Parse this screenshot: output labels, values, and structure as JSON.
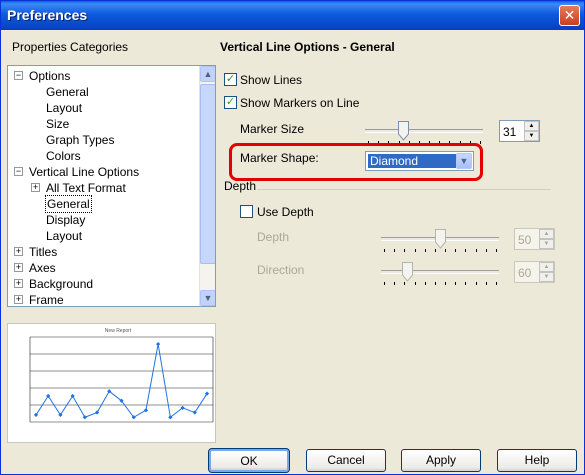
{
  "window": {
    "title": "Preferences"
  },
  "left_panel": {
    "heading": "Properties Categories",
    "tree": [
      {
        "label": "Options",
        "expander": "−",
        "level": 0
      },
      {
        "label": "General",
        "level": 1
      },
      {
        "label": "Layout",
        "level": 1
      },
      {
        "label": "Size",
        "level": 1
      },
      {
        "label": "Graph Types",
        "level": 1
      },
      {
        "label": "Colors",
        "level": 1
      },
      {
        "label": "Vertical Line Options",
        "expander": "−",
        "level": 0
      },
      {
        "label": "All Text Format",
        "expander": "+",
        "level": 1
      },
      {
        "label": "General",
        "level": 1,
        "selected": true
      },
      {
        "label": "Display",
        "level": 1
      },
      {
        "label": "Layout",
        "level": 1
      },
      {
        "label": "Titles",
        "expander": "+",
        "level": 0
      },
      {
        "label": "Axes",
        "expander": "+",
        "level": 0
      },
      {
        "label": "Background",
        "expander": "+",
        "level": 0
      },
      {
        "label": "Frame",
        "expander": "+",
        "level": 0
      }
    ],
    "preview": {
      "title": "New Report",
      "values": [
        3,
        11,
        3,
        11,
        2,
        4,
        13,
        9,
        2,
        5,
        33,
        2,
        6,
        4,
        12
      ]
    }
  },
  "right_panel": {
    "heading": "Vertical Line Options - General",
    "show_lines": {
      "label": "Show Lines",
      "checked": true
    },
    "show_markers": {
      "label": "Show Markers on Line",
      "checked": true
    },
    "marker_size": {
      "label": "Marker Size",
      "value": "31",
      "slider_fraction": 0.31
    },
    "marker_shape": {
      "label": "Marker Shape:",
      "value": "Diamond"
    },
    "depth_group": {
      "label": "Depth",
      "use_depth": {
        "label": "Use Depth",
        "checked": false
      },
      "depth": {
        "label": "Depth",
        "value": "50",
        "slider_fraction": 0.5
      },
      "direction": {
        "label": "Direction",
        "value": "60",
        "slider_fraction": 0.2
      }
    }
  },
  "buttons": {
    "ok": "OK",
    "cancel": "Cancel",
    "apply": "Apply",
    "help": "Help"
  },
  "colors": {
    "titlebar": "#0A5FE8",
    "selection": "#316AC5",
    "highlight": "#E40000",
    "face": "#ECE9D8"
  }
}
